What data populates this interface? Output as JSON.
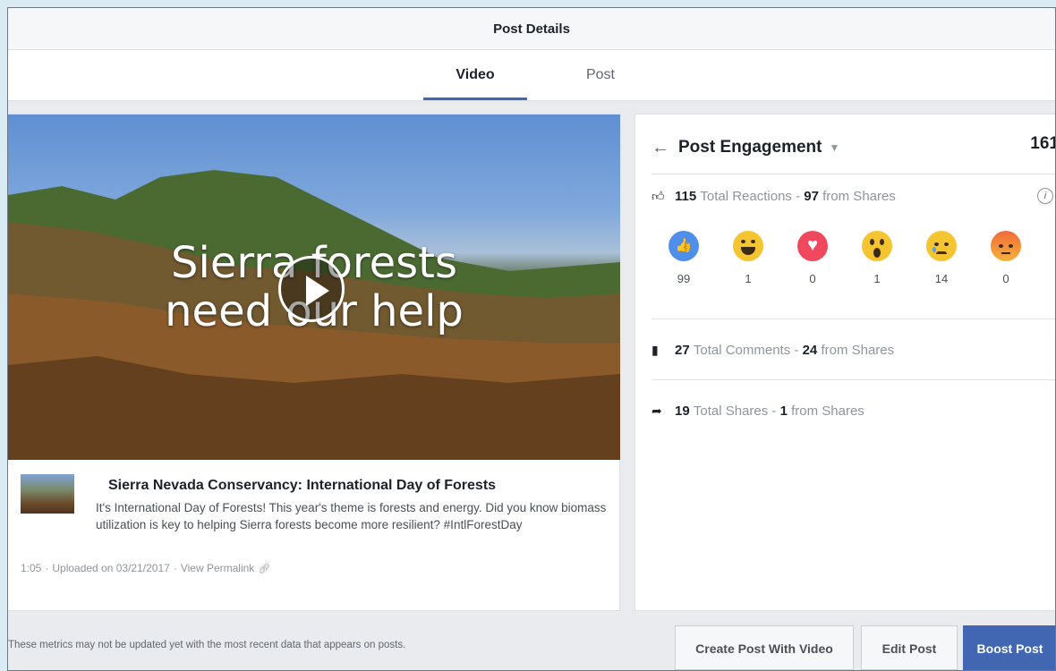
{
  "dialog": {
    "title": "Post Details",
    "tabs": [
      {
        "label": "Video",
        "active": true
      },
      {
        "label": "Post",
        "active": false
      }
    ]
  },
  "video": {
    "overlay_line1": "Sierra forests",
    "overlay_line2": "need our help",
    "title": "Sierra Nevada Conservancy: International Day of Forests",
    "description": "It's International Day of Forests! This year's theme is forests and energy. Did you know biomass utilization is key to helping Sierra forests become more resilient? #IntlForestDay",
    "duration": "1:05",
    "separator": "·",
    "uploaded": "Uploaded on 03/21/2017",
    "permalink_label": "View Permalink"
  },
  "engagement": {
    "title": "Post Engagement",
    "total": "161",
    "reactions": {
      "count": "115",
      "label": "Total Reactions",
      "dash": "-",
      "shares_count": "97",
      "shares_label": "from Shares",
      "items": [
        {
          "icon": "like-icon",
          "count": "99"
        },
        {
          "icon": "haha-icon",
          "count": "1"
        },
        {
          "icon": "love-icon",
          "count": "0"
        },
        {
          "icon": "wow-icon",
          "count": "1"
        },
        {
          "icon": "sad-icon",
          "count": "14"
        },
        {
          "icon": "angry-icon",
          "count": "0"
        }
      ]
    },
    "comments": {
      "count": "27",
      "label": "Total Comments",
      "dash": "-",
      "shares_count": "24",
      "shares_label": "from Shares"
    },
    "shares": {
      "count": "19",
      "label": "Total Shares",
      "dash": "-",
      "shares_count": "1",
      "shares_label": "from Shares"
    }
  },
  "footer": {
    "note": "These metrics may not be updated yet with the most recent data that appears on posts.",
    "create_label": "Create Post With Video",
    "edit_label": "Edit Post",
    "boost_label": "Boost Post"
  },
  "colors": {
    "accent": "#4267b2",
    "like": "#4f8fea",
    "love": "#f0485d",
    "emoji_yellow": "#f5c531"
  }
}
